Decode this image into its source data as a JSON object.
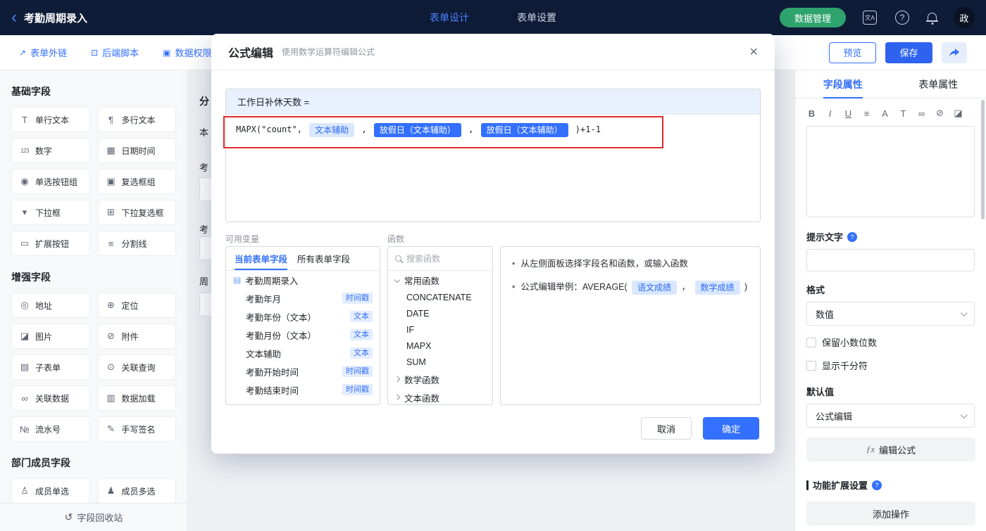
{
  "colors": {
    "accent": "#3370FF",
    "topbar_bg": "#0E1C38",
    "green": "#2FA36E",
    "annotation_red": "#E02A2A",
    "tag_light_bg": "#D9E7FF",
    "tag_selected_bg": "#3370FF",
    "canvas_bg": "#EEF0F3"
  },
  "topbar": {
    "title": "考勤周期录入",
    "tabs": [
      {
        "label": "表单设计",
        "active": true
      },
      {
        "label": "表单设置",
        "active": false
      }
    ],
    "data_manage_label": "数据管理",
    "icons": [
      {
        "name": "translate-icon",
        "type": "square",
        "glyph": "文A"
      },
      {
        "name": "help-icon",
        "type": "circle",
        "glyph": "?"
      },
      {
        "name": "bell-icon",
        "type": "bell",
        "glyph": ""
      }
    ],
    "avatar_text": "政"
  },
  "toolbar": {
    "items": [
      {
        "icon": "external-link-icon",
        "glyph": "↗",
        "label": "表单外链"
      },
      {
        "icon": "backend-script-icon",
        "glyph": "⊡",
        "label": "后端脚本"
      },
      {
        "icon": "data-permission-icon",
        "glyph": "▣",
        "label": "数据权限"
      }
    ],
    "preview_label": "预览",
    "save_label": "保存"
  },
  "sidebar": {
    "sections": [
      {
        "title": "基础字段",
        "fields": [
          {
            "name": "单行文本",
            "icon": "single-line-text-icon",
            "glyph": "T"
          },
          {
            "name": "多行文本",
            "icon": "multi-line-text-icon",
            "glyph": "¶"
          },
          {
            "name": "数字",
            "icon": "number-icon",
            "glyph": "123"
          },
          {
            "name": "日期时间",
            "icon": "datetime-icon",
            "glyph": "▦"
          },
          {
            "name": "单选按钮组",
            "icon": "radio-group-icon",
            "glyph": "◉"
          },
          {
            "name": "复选框组",
            "icon": "checkbox-group-icon",
            "glyph": "▣"
          },
          {
            "name": "下拉框",
            "icon": "dropdown-icon",
            "glyph": "▾"
          },
          {
            "name": "下拉复选框",
            "icon": "dropdown-multi-icon",
            "glyph": "⊞"
          },
          {
            "name": "扩展按钮",
            "icon": "extension-button-icon",
            "glyph": "▭"
          },
          {
            "name": "分割线",
            "icon": "divider-icon",
            "glyph": "≡"
          }
        ]
      },
      {
        "title": "增强字段",
        "fields": [
          {
            "name": "地址",
            "icon": "address-icon",
            "glyph": "◎"
          },
          {
            "name": "定位",
            "icon": "location-icon",
            "glyph": "⊕"
          },
          {
            "name": "图片",
            "icon": "image-field-icon",
            "glyph": "◪"
          },
          {
            "name": "附件",
            "icon": "attachment-icon",
            "glyph": "⊘"
          },
          {
            "name": "子表单",
            "icon": "subform-icon",
            "glyph": "▤"
          },
          {
            "name": "关联查询",
            "icon": "lookup-icon",
            "glyph": "⊙"
          },
          {
            "name": "关联数据",
            "icon": "linked-data-icon",
            "glyph": "∞"
          },
          {
            "name": "数据加载",
            "icon": "data-load-icon",
            "glyph": "▥"
          },
          {
            "name": "流水号",
            "icon": "serial-number-icon",
            "glyph": "№"
          },
          {
            "name": "手写签名",
            "icon": "signature-icon",
            "glyph": "✎"
          }
        ]
      },
      {
        "title": "部门成员字段",
        "fields": [
          {
            "name": "成员单选",
            "icon": "member-single-icon",
            "glyph": "♙"
          },
          {
            "name": "成员多选",
            "icon": "member-multi-icon",
            "glyph": "♟"
          }
        ]
      }
    ],
    "recycle_label": "字段回收站"
  },
  "canvas": {
    "fragments": [
      "分",
      "本",
      "考",
      "考",
      "周"
    ]
  },
  "modal": {
    "title": "公式编辑",
    "subtitle": "使用数学运算符编辑公式",
    "formula": {
      "target_label": "工作日补休天数 =",
      "tokens": [
        {
          "type": "text",
          "value": "MAPX(\"count\", "
        },
        {
          "type": "tag",
          "value": "文本辅助",
          "selected": false
        },
        {
          "type": "text",
          "value": " , "
        },
        {
          "type": "tag",
          "value": "放假日（文本辅助）",
          "selected": true
        },
        {
          "type": "text",
          "value": " , "
        },
        {
          "type": "tag",
          "value": "放假日（文本辅助）",
          "selected": true
        },
        {
          "type": "text",
          "value": " )+1-1"
        }
      ]
    },
    "variables": {
      "section_label": "可用变量",
      "tabs": [
        {
          "label": "当前表单字段",
          "active": true
        },
        {
          "label": "所有表单字段",
          "active": false
        }
      ],
      "tree": [
        {
          "name": "考勤周期录入",
          "tag": "",
          "root": true,
          "icon": "form-doc-icon",
          "glyph": "▤"
        },
        {
          "name": "考勤年月",
          "tag": "时间戳"
        },
        {
          "name": "考勤年份（文本）",
          "tag": "文本"
        },
        {
          "name": "考勤月份（文本）",
          "tag": "文本"
        },
        {
          "name": "文本辅助",
          "tag": "文本"
        },
        {
          "name": "考勤开始时间",
          "tag": "时间戳"
        },
        {
          "name": "考勤结束时间",
          "tag": "时间戳"
        }
      ]
    },
    "functions": {
      "section_label": "函数",
      "search_placeholder": "搜索函数",
      "groups": [
        {
          "label": "常用函数",
          "expanded": true,
          "items": [
            "CONCATENATE",
            "DATE",
            "IF",
            "MAPX",
            "SUM"
          ]
        },
        {
          "label": "数学函数",
          "expanded": false,
          "items": []
        },
        {
          "label": "文本函数",
          "expanded": false,
          "items": []
        }
      ]
    },
    "help": {
      "line1": "从左侧面板选择字段名和函数，或输入函数",
      "line2_prefix": "公式编辑举例：AVERAGE( ",
      "line2_tags": [
        "语文成绩",
        "数学成绩"
      ],
      "line2_separator": " ， ",
      "line2_suffix": " )"
    },
    "cancel_label": "取消",
    "ok_label": "确定"
  },
  "right_panel": {
    "tabs": [
      {
        "label": "字段属性",
        "active": true
      },
      {
        "label": "表单属性",
        "active": false
      }
    ],
    "rte_icons": [
      {
        "name": "bold-icon",
        "glyph": "B"
      },
      {
        "name": "italic-icon",
        "glyph": "I"
      },
      {
        "name": "underline-icon",
        "glyph": "U"
      },
      {
        "name": "align-icon",
        "glyph": "≡"
      },
      {
        "name": "font-color-icon",
        "glyph": "A"
      },
      {
        "name": "font-size-icon",
        "glyph": "T"
      },
      {
        "name": "link-icon",
        "glyph": "∞"
      },
      {
        "name": "unlink-icon",
        "glyph": "⊘"
      },
      {
        "name": "insert-image-icon",
        "glyph": "◪"
      }
    ],
    "hint_label": "提示文字",
    "format_label": "格式",
    "format_value": "数值",
    "checkboxes": [
      {
        "label": "保留小数位数",
        "checked": false
      },
      {
        "label": "显示千分符",
        "checked": false
      }
    ],
    "default_label": "默认值",
    "default_value": "公式编辑",
    "edit_formula_label": "编辑公式",
    "ext_settings_label": "功能扩展设置",
    "add_action_label": "添加操作"
  }
}
